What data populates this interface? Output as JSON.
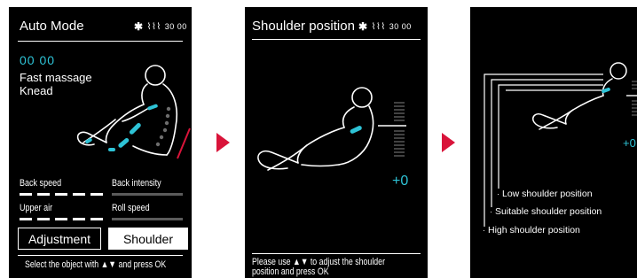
{
  "screens": [
    {
      "title": "Auto Mode",
      "status": {
        "time": "30 00"
      },
      "timer": "00 00",
      "program": {
        "line1": "Fast massage",
        "line2": "Knead"
      },
      "controls": {
        "back_speed": "Back speed",
        "back_intensity": "Back intensity",
        "upper_air": "Upper air",
        "roll_speed": "Roll speed"
      },
      "buttons": {
        "adjustment": "Adjustment",
        "shoulder": "Shoulder"
      },
      "hint": "Select the object with ▲▼ and press OK"
    },
    {
      "title": "Shoulder position",
      "status": {
        "time": "30 00"
      },
      "offset": "+0",
      "hint_line1": "Please use ▲▼ to adjust the shoulder",
      "hint_line2": "position and press OK"
    },
    {
      "offset": "+0",
      "positions": {
        "low": "Low shoulder position",
        "suitable": "Suitable shoulder position",
        "high": "High shoulder position"
      }
    }
  ],
  "icons": {
    "bluetooth": "bluetooth-icon",
    "heat": "heat-icon",
    "next": "arrow-right-icon"
  },
  "colors": {
    "accent": "#2ec3d6",
    "arrow": "#d9143a",
    "background": "#000000"
  }
}
